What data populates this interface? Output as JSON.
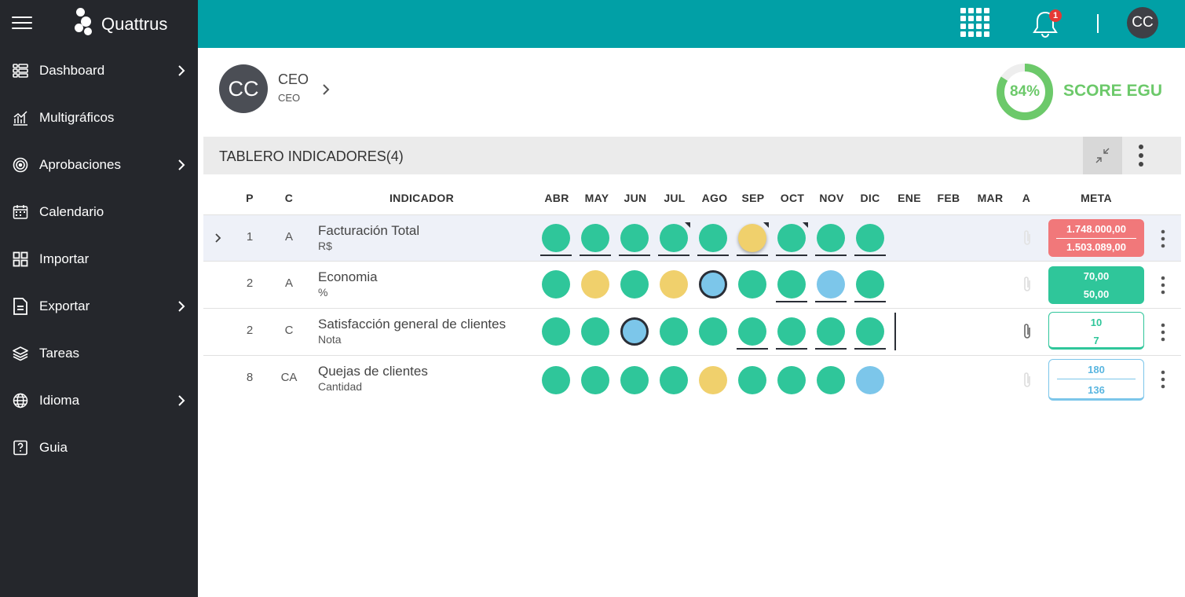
{
  "app": {
    "brand": "Quattrus",
    "notifications": "1",
    "user_initials": "CC"
  },
  "sidebar": {
    "items": [
      {
        "label": "Dashboard",
        "icon": "list-icon",
        "chevron": true
      },
      {
        "label": "Multigráficos",
        "icon": "chart-icon",
        "chevron": false
      },
      {
        "label": "Aprobaciones",
        "icon": "target-icon",
        "chevron": true
      },
      {
        "label": "Calendario",
        "icon": "calendar-icon",
        "chevron": false
      },
      {
        "label": "Importar",
        "icon": "grid-icon",
        "chevron": false
      },
      {
        "label": "Exportar",
        "icon": "document-icon",
        "chevron": true
      },
      {
        "label": "Tareas",
        "icon": "layers-icon",
        "chevron": false
      },
      {
        "label": "Idioma",
        "icon": "globe-icon",
        "chevron": true
      },
      {
        "label": "Guia",
        "icon": "help-book-icon",
        "chevron": false
      }
    ]
  },
  "profile": {
    "initials": "CC",
    "name": "CEO",
    "role": "CEO"
  },
  "score": {
    "value": 84,
    "label_pct": "84%",
    "label": "SCORE EGU",
    "color": "#6cc96a"
  },
  "panel": {
    "title": "TABLERO INDICADORES(4)"
  },
  "table": {
    "headers": {
      "p": "P",
      "c": "C",
      "indicator": "INDICADOR",
      "a": "A",
      "meta": "META"
    },
    "months": [
      "ABR",
      "MAY",
      "JUN",
      "JUL",
      "AGO",
      "SEP",
      "OCT",
      "NOV",
      "DIC",
      "ENE",
      "FEB",
      "MAR"
    ],
    "rows": [
      {
        "p": "1",
        "c": "A",
        "name": "Facturación Total",
        "unit": "R$",
        "meta_top": "1.748.000,00",
        "meta_bottom": "1.503.089,00",
        "meta_style": "red"
      },
      {
        "p": "2",
        "c": "A",
        "name": "Economia",
        "unit": "%",
        "meta_top": "70,00",
        "meta_bottom": "50,00",
        "meta_style": "teal"
      },
      {
        "p": "2",
        "c": "C",
        "name": "Satisfacción general de clientes",
        "unit": "Nota",
        "meta_top": "10",
        "meta_bottom": "7",
        "meta_style": "outline-teal"
      },
      {
        "p": "8",
        "c": "CA",
        "name": "Quejas de clientes",
        "unit": "Cantidad",
        "meta_top": "180",
        "meta_bottom": "136",
        "meta_style": "outline-blue"
      }
    ]
  },
  "colors": {
    "green": "#2fc69a",
    "yellow": "#f0d06c",
    "blue": "#7cc6ea",
    "topbar": "#01a0a6",
    "sidebar": "#25272c",
    "meta_red": "#f1787a"
  }
}
